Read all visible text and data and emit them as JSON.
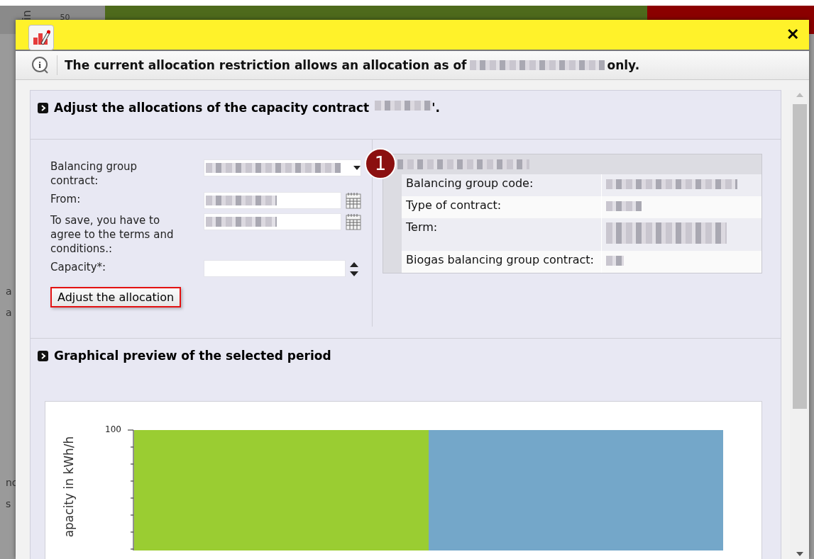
{
  "backdrop": {
    "axis_label": "in",
    "tick": "50",
    "side_texts": [
      "a",
      "a",
      "nc",
      "s"
    ]
  },
  "dialog": {
    "close": "✕",
    "info_glyph": "i",
    "info": {
      "before": "The current allocation restriction allows an allocation as of",
      "after": "only."
    },
    "section_title": "Adjust the allocations of the capacity contract",
    "section_title_end": "'.",
    "form": {
      "fields": [
        {
          "kind": "select",
          "label": "Balancing group contract:"
        },
        {
          "kind": "date",
          "label": "From:"
        },
        {
          "kind": "date",
          "label": "To save, you have to agree to the terms and conditions.:"
        },
        {
          "kind": "spinner",
          "label": "Capacity*:"
        }
      ],
      "button": "Adjust the allocation",
      "badge": "1"
    },
    "details": [
      {
        "label": "Balancing group code:"
      },
      {
        "label": "Type of contract:"
      },
      {
        "label": "Term:"
      },
      {
        "label": "Biogas balancing group contract:"
      }
    ],
    "preview_title": "Graphical preview of the selected period",
    "chart": {
      "ylabel": "apacity in kWh/h",
      "top_tick": "100"
    }
  }
}
